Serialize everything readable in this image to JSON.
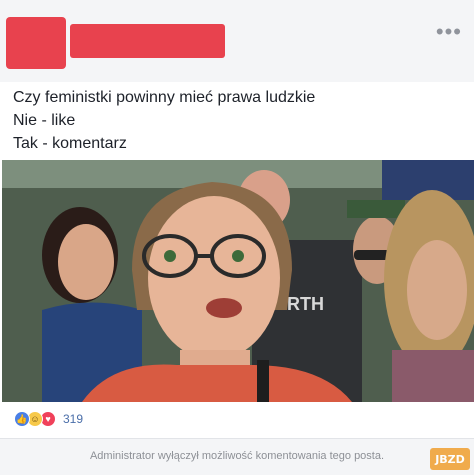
{
  "header": {
    "more_label": "•••"
  },
  "post": {
    "lines": [
      "Czy feministki powinny mieć prawa ludzkie",
      "Nie - like",
      "Tak - komentarz"
    ]
  },
  "photo": {
    "shirt_logo_text": "RTH",
    "colors": {
      "background_crowd": "#5a6b5a",
      "main_shirt": "#d85b42",
      "skin": "#e7b598",
      "hair": "#8a6a49"
    }
  },
  "reactions": {
    "icons": [
      "like-icon",
      "haha-icon",
      "love-icon"
    ],
    "count": "319"
  },
  "footer": {
    "notice": "Administrator wyłączył możliwość komentowania tego posta."
  },
  "watermark": {
    "text": "JBZD"
  }
}
